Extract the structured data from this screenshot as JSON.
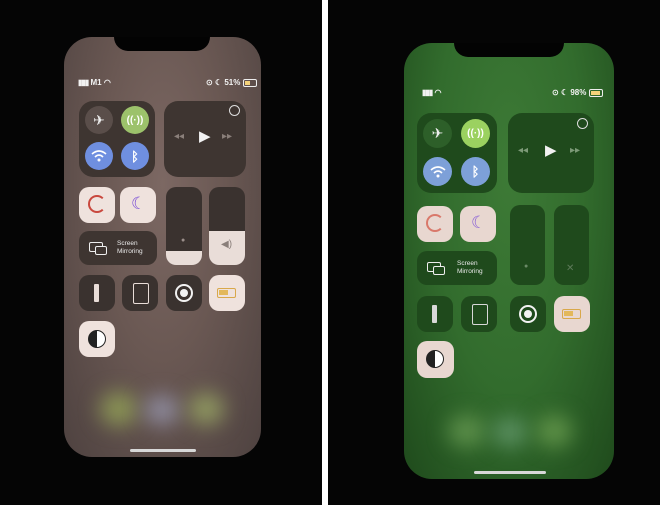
{
  "left_phone": {
    "status": {
      "carrier": "M1",
      "battery": "51%"
    },
    "screen_mirroring_label": [
      "Screen",
      "Mirroring"
    ],
    "screen_tint": "#6a5a55"
  },
  "right_phone": {
    "status": {
      "battery": "98%"
    },
    "screen_mirroring_label": [
      "Screen",
      "Mirroring"
    ],
    "screen_tint": "#2f6a2b"
  },
  "icons": [
    "airplane-icon",
    "cellular-icon",
    "wifi-icon",
    "bluetooth-icon",
    "airplay-icon",
    "rewind-icon",
    "play-icon",
    "fast-forward-icon",
    "rotation-lock-icon",
    "moon-icon",
    "screen-mirroring-icon",
    "brightness-icon",
    "volume-icon",
    "flashlight-icon",
    "calculator-icon",
    "record-icon",
    "battery-icon",
    "dark-mode-icon"
  ],
  "colors": {
    "divider": "#ffffff",
    "accent_green": "#8bc34a",
    "accent_blue": "#2d6fe0"
  }
}
